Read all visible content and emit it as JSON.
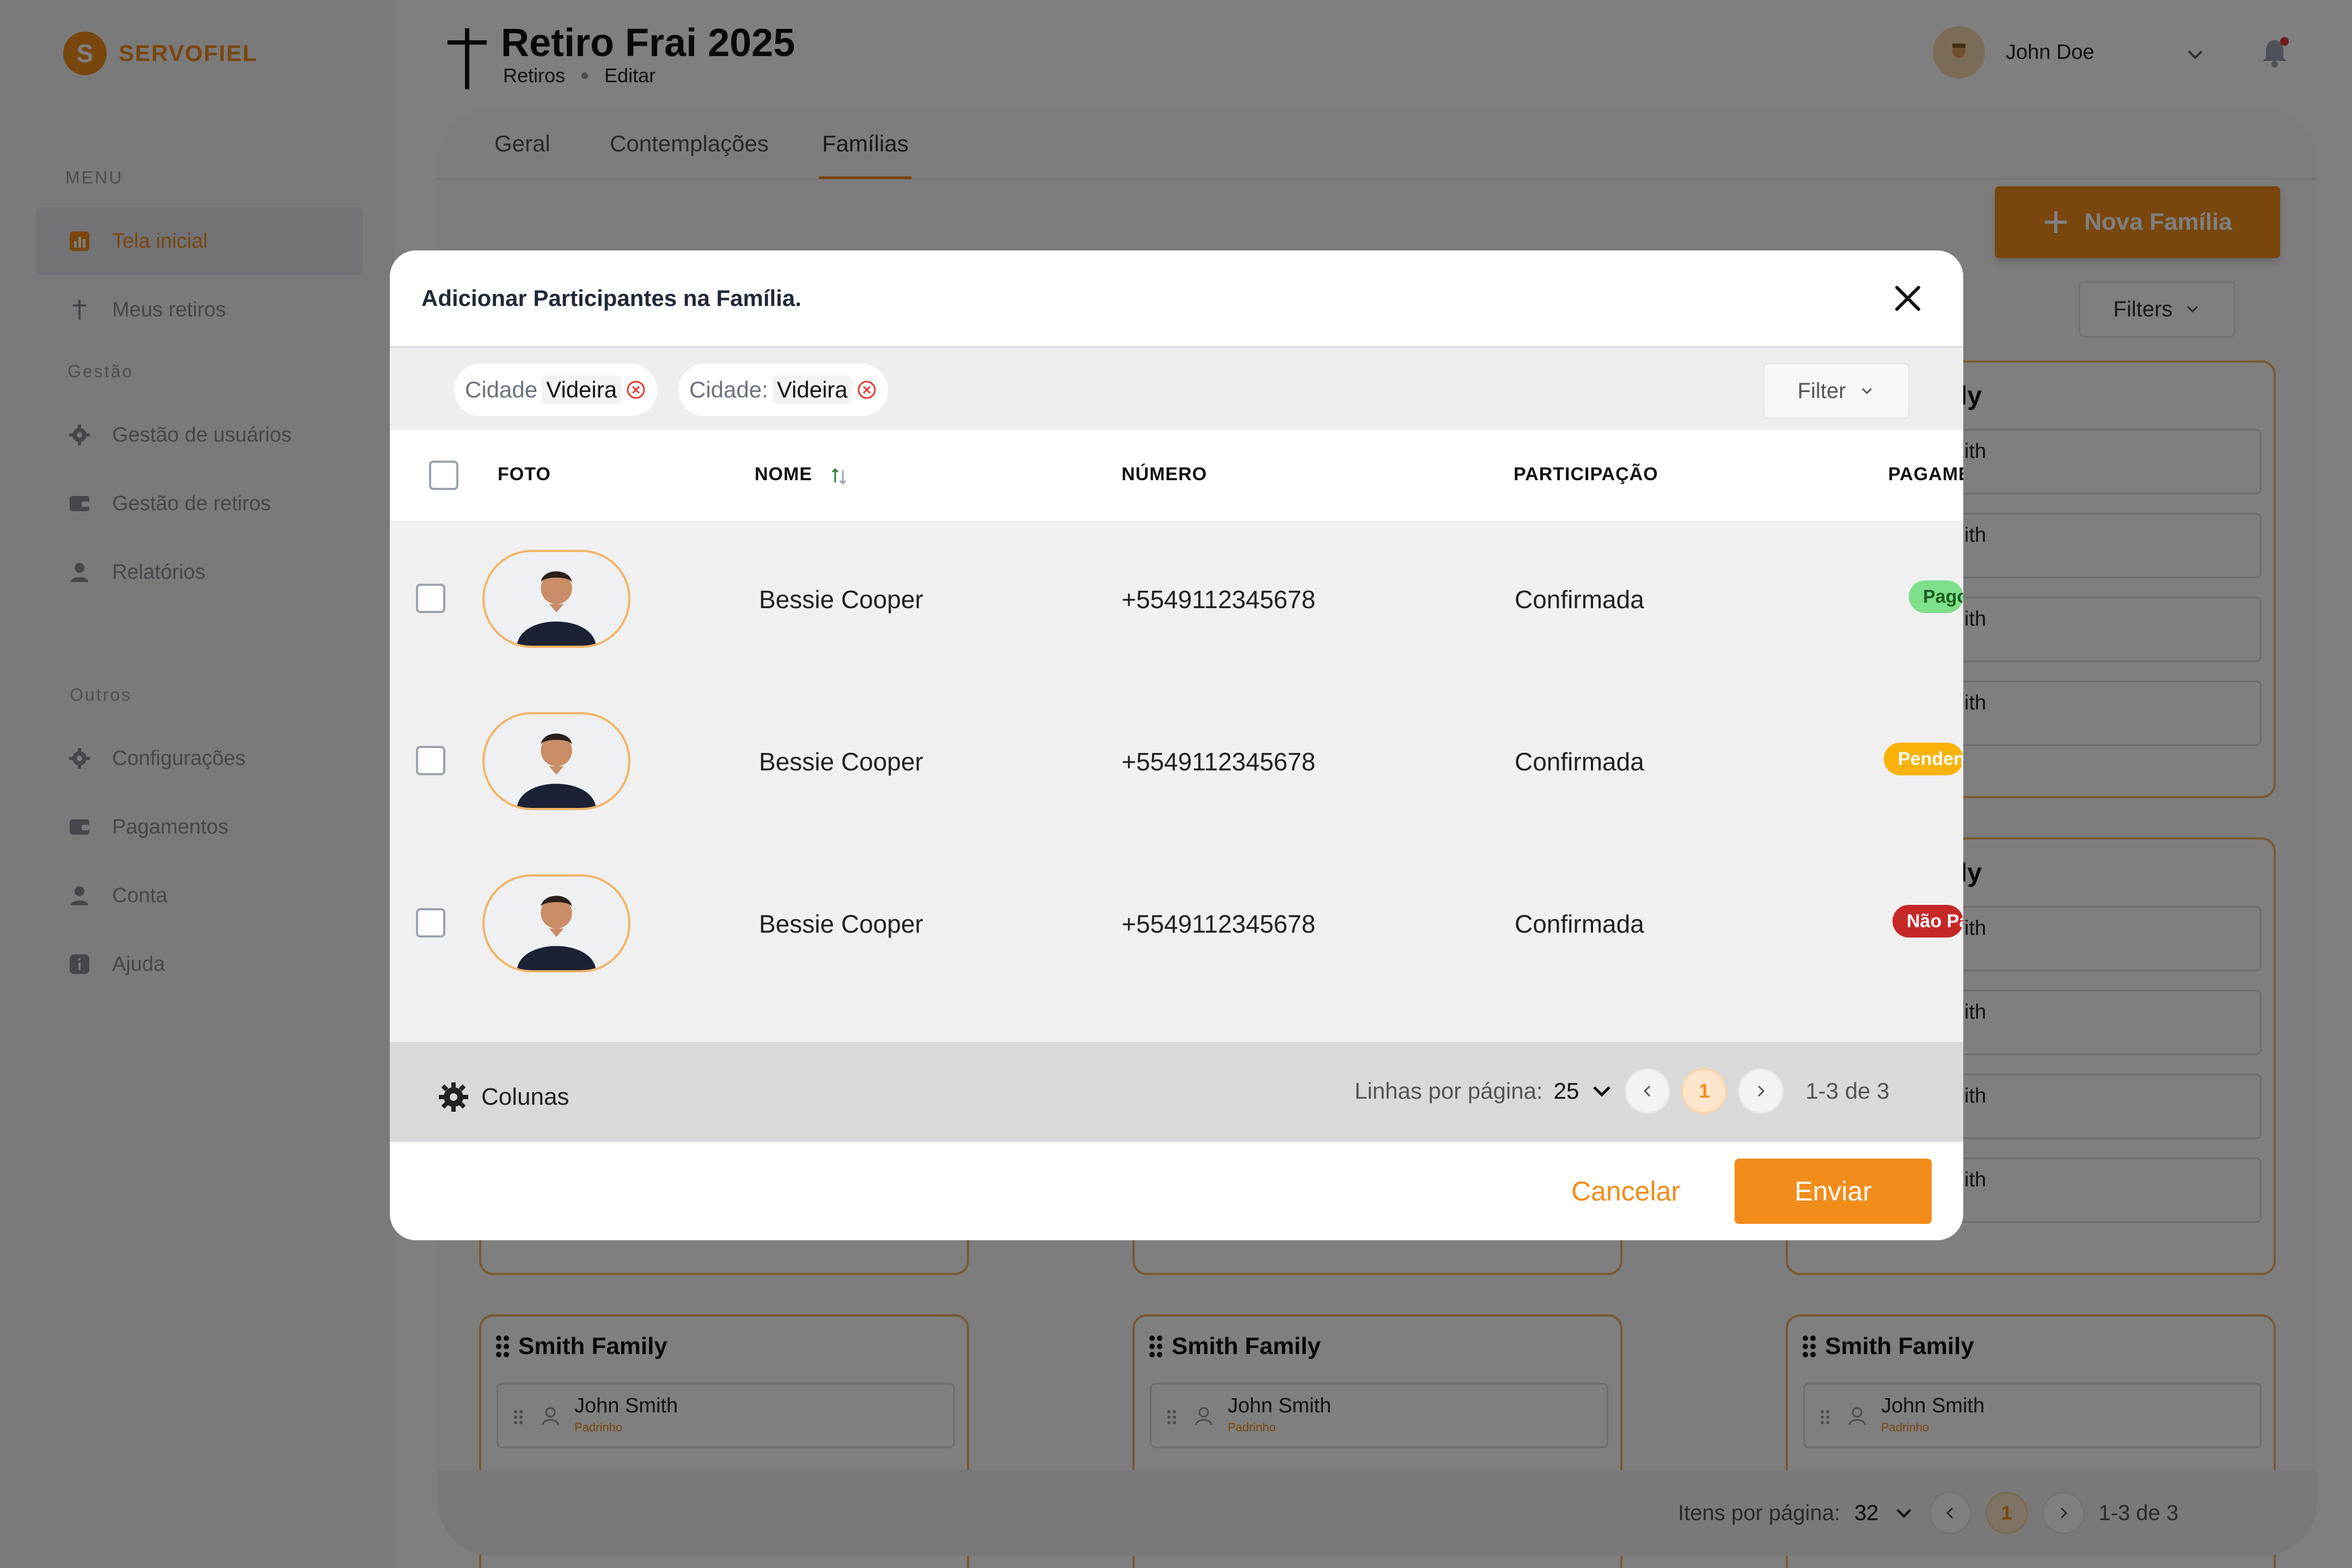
{
  "brand": {
    "initial": "S",
    "name": "SERVOFIEL"
  },
  "sidebar": {
    "sections": [
      {
        "label": "MENU"
      },
      {
        "label": "Gestão"
      },
      {
        "label": "Outros"
      }
    ],
    "items": [
      {
        "label": "Tela inicial",
        "icon": "chart-icon",
        "active": true
      },
      {
        "label": "Meus retiros",
        "icon": "cross-icon"
      },
      {
        "label": "Gestão de usuários",
        "icon": "gear-icon"
      },
      {
        "label": "Gestão de retiros",
        "icon": "wallet-icon"
      },
      {
        "label": "Relatórios",
        "icon": "user-icon"
      },
      {
        "label": "Configurações",
        "icon": "gear-icon"
      },
      {
        "label": "Pagamentos",
        "icon": "wallet-icon"
      },
      {
        "label": "Conta",
        "icon": "user-icon"
      },
      {
        "label": "Ajuda",
        "icon": "info-icon"
      }
    ]
  },
  "header": {
    "title": "Retiro Frai 2025",
    "breadcrumb": [
      "Retiros",
      "Editar"
    ],
    "user_name": "John Doe"
  },
  "tabs": [
    "Geral",
    "Contemplações",
    "Famílias"
  ],
  "families": {
    "new_button": "Nova Família",
    "filters_label": "Filters",
    "card_title": "Smith Family",
    "member_name": "John Smith",
    "member_role": "Padrinho",
    "partial_text": "ith",
    "partial_title": "ly",
    "pager": {
      "label": "Itens por página:",
      "per_page": "32",
      "current": "1",
      "range": "1-3 de 3"
    }
  },
  "modal": {
    "title": "Adicionar Participantes na Família.",
    "chips": [
      {
        "key": "Cidade",
        "value": "Videira"
      },
      {
        "key": "Cidade:",
        "value": "Videira"
      }
    ],
    "filter_label": "Filter",
    "columns": [
      "FOTO",
      "NOME",
      "NÚMERO",
      "PARTICIPAÇÃO",
      "PAGAMENTO"
    ],
    "rows": [
      {
        "name": "Bessie Cooper",
        "phone": "+5549112345678",
        "participation": "Confirmada",
        "payment": "Pago",
        "payment_color": "#7ee08a",
        "payment_text_color": "#1b5e20"
      },
      {
        "name": "Bessie Cooper",
        "phone": "+5549112345678",
        "participation": "Confirmada",
        "payment": "Pendente",
        "payment_color": "#f9b208",
        "payment_text_color": "#ffffff"
      },
      {
        "name": "Bessie Cooper",
        "phone": "+5549112345678",
        "participation": "Confirmada",
        "payment": "Não Pago",
        "payment_color": "#c62828",
        "payment_text_color": "#ffffff"
      }
    ],
    "columns_button": "Colunas",
    "pager": {
      "label": "Linhas por página:",
      "per_page": "25",
      "current": "1",
      "range": "1-3 de 3"
    },
    "cancel": "Cancelar",
    "submit": "Enviar"
  },
  "colors": {
    "accent": "#f28c1b",
    "card_border": "#f2b466"
  }
}
